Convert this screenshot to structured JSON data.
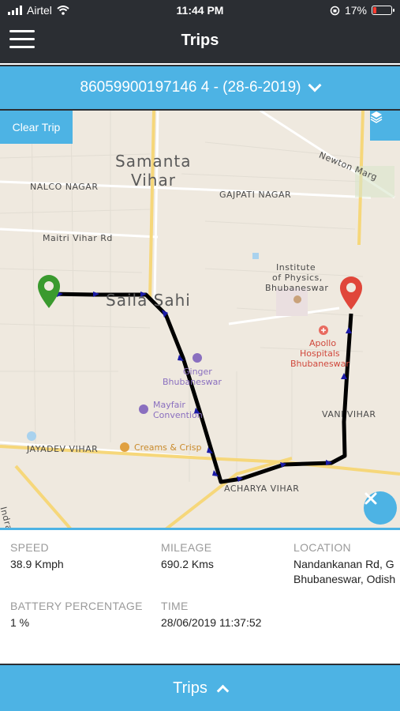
{
  "status_bar": {
    "carrier": "Airtel",
    "time": "11:44 PM",
    "battery": "17%",
    "icons": [
      "signal-icon",
      "wifi-icon",
      "orientation-lock-icon",
      "battery-icon"
    ]
  },
  "header": {
    "title": "Trips",
    "menu_icon": "hamburger-menu-icon"
  },
  "selector": {
    "label": "86059900197146 4 - (28-6-2019)",
    "icon": "chevron-down-icon"
  },
  "map": {
    "clear_trip_label": "Clear Trip",
    "layers_icon": "layers-icon",
    "close_icon": "close-icon",
    "colors": {
      "route": "#000000",
      "arrow": "#1a1aa6",
      "start_pin": "#3a9a2e",
      "end_pin": "#e0463a"
    },
    "labels": {
      "samanta": "Samanta",
      "vihar": "Vihar",
      "nalco": "NALCO NAGAR",
      "gajpati": "GAJPATI NAGAR",
      "maitri": "Maitri Vihar Rd",
      "newton": "Newton Marg",
      "sailasahi": "Saila Sahi",
      "inst1": "Institute",
      "inst2": "of Physics,",
      "inst3": "Bhubaneswar",
      "apollo1": "Apollo",
      "apollo2": "Hospitals",
      "apollo3": "Bhubaneswar",
      "ginger1": "Ginger",
      "ginger2": "Bhubaneswar",
      "mayfair1": "Mayfair",
      "mayfair2": "Convention",
      "vani": "VANI VIHAR",
      "jayadev": "JAYADEV VIHAR",
      "creams": "Creams & Crisp",
      "acharya": "ACHARYA VIHAR",
      "indradhanu": "Indradhanu Ma"
    }
  },
  "info": {
    "speed_label": "SPEED",
    "speed_value": "38.9 Kmph",
    "mileage_label": "MILEAGE",
    "mileage_value": "690.2 Kms",
    "location_label": "LOCATION",
    "location_line1": "Nandankanan Rd, G",
    "location_line2": "Bhubaneswar, Odish",
    "battery_label": "BATTERY PERCENTAGE",
    "battery_value": "1 %",
    "time_label": "TIME",
    "time_value": "28/06/2019 11:37:52"
  },
  "bottom_bar": {
    "label": "Trips",
    "icon": "chevron-up-icon"
  }
}
